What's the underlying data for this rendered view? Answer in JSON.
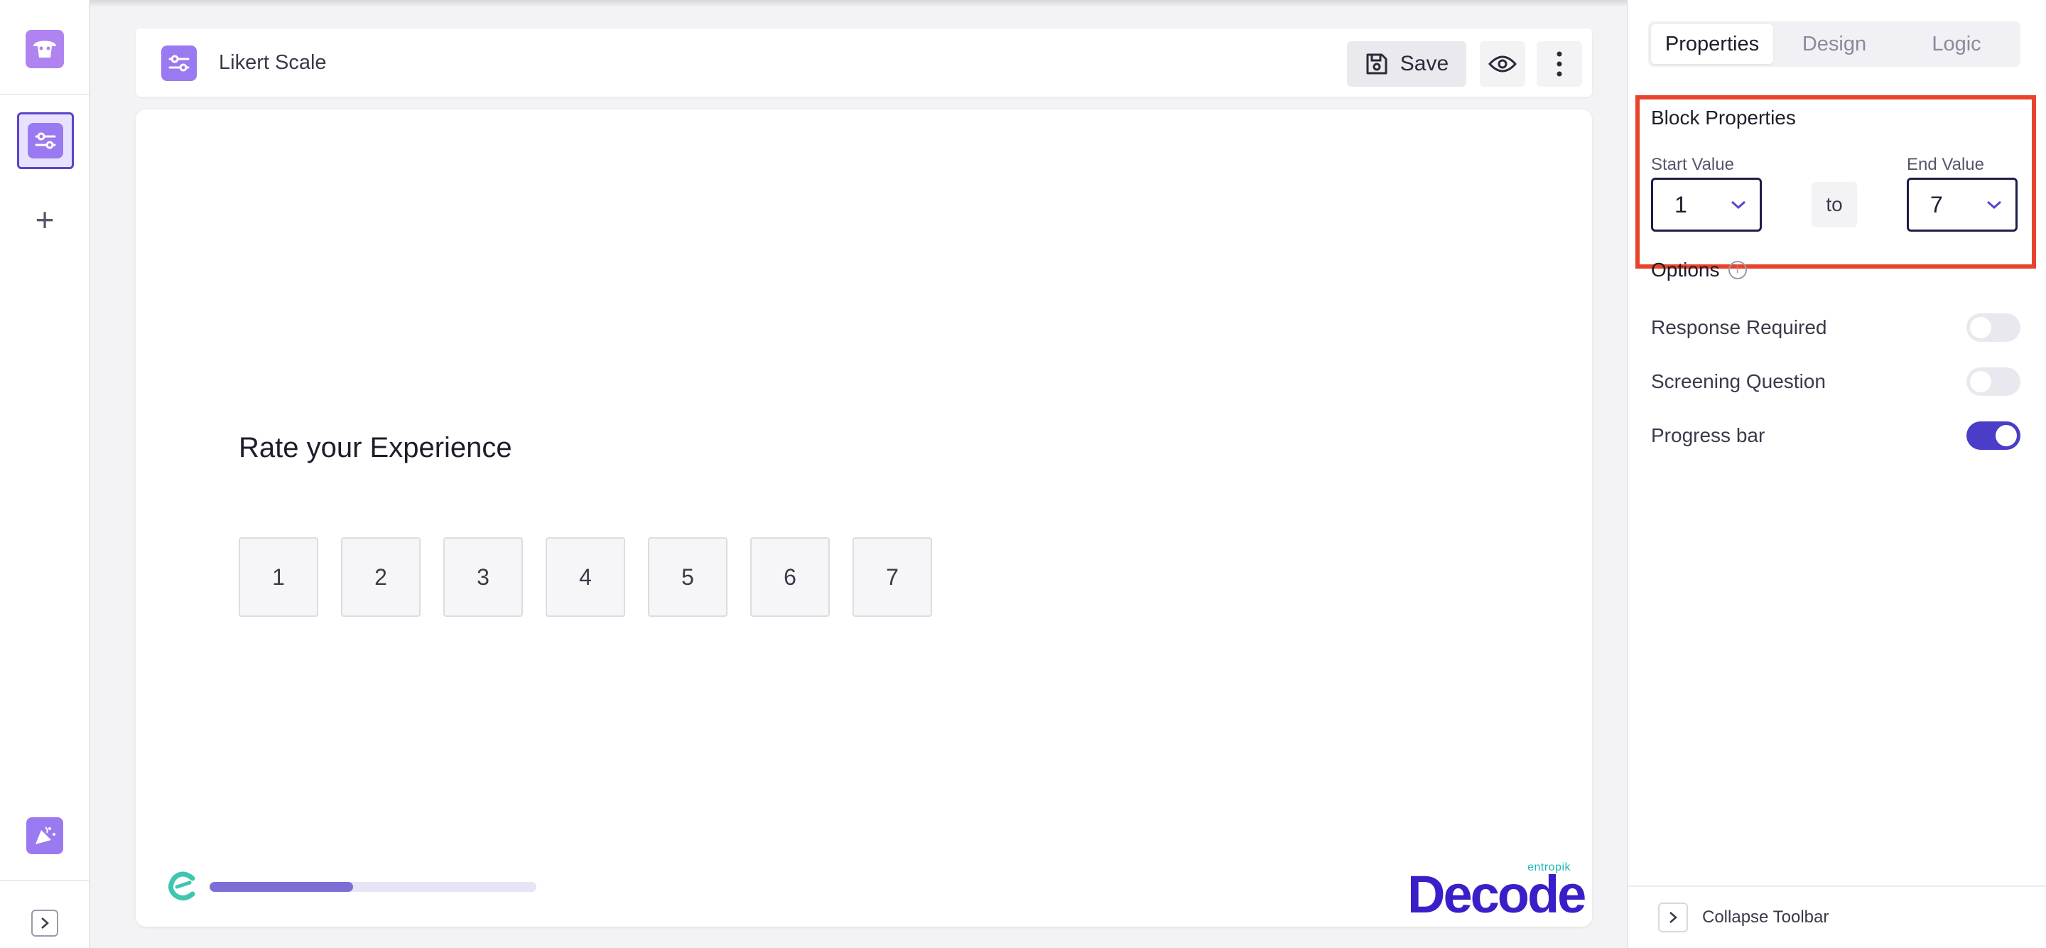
{
  "header": {
    "title": "Likert Scale",
    "save_label": "Save"
  },
  "canvas": {
    "question": "Rate your Experience",
    "scale_values": [
      "1",
      "2",
      "3",
      "4",
      "5",
      "6",
      "7"
    ],
    "progress_fraction": 0.44,
    "brand_tagline": "entropik",
    "brand_name": "Decode"
  },
  "panel": {
    "tabs": [
      {
        "label": "Properties",
        "active": true
      },
      {
        "label": "Design",
        "active": false
      },
      {
        "label": "Logic",
        "active": false
      }
    ],
    "block_properties_title": "Block Properties",
    "start_value_label": "Start Value",
    "start_value": "1",
    "to_label": "to",
    "end_value_label": "End Value",
    "end_value": "7",
    "options_title": "Options",
    "options": [
      {
        "label": "Response Required",
        "on": false
      },
      {
        "label": "Screening Question",
        "on": false
      },
      {
        "label": "Progress bar",
        "on": true
      }
    ],
    "collapse_label": "Collapse Toolbar"
  },
  "colors": {
    "accent": "#4a3dc8",
    "block_icon": "#9a7af0",
    "highlight": "#e8432b",
    "progress": "#7b6fd6"
  },
  "icons": {
    "brand": "brand-logo-icon",
    "block": "slider-block-icon",
    "add": "plus-icon",
    "celebrate": "celebrate-icon",
    "expand": "chevron-right-icon",
    "save": "floppy-disk-icon",
    "preview": "eye-icon",
    "more": "kebab-menu-icon",
    "info": "info-icon",
    "dropdown": "chevron-down-icon"
  }
}
